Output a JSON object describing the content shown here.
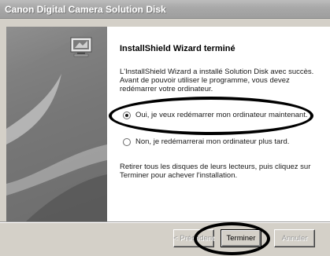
{
  "window": {
    "title": "Canon Digital Camera Solution Disk"
  },
  "wizard": {
    "heading": "InstallShield Wizard terminé",
    "message": "L'InstallShield Wizard a installé Solution Disk avec succès. Avant de pouvoir utiliser le programme, vous devez redémarrer votre ordinateur.",
    "options": [
      {
        "label": "Oui, je veux redémarrer mon ordinateur maintenant.",
        "selected": true
      },
      {
        "label": "Non, je redémarrerai mon ordinateur plus tard.",
        "selected": false
      }
    ],
    "instruction": "Retirer tous les disques de leurs lecteurs, puis cliquez sur Terminer pour achever l'installation."
  },
  "buttons": {
    "previous": "< Précédent",
    "finish": "Terminer",
    "cancel": "Annuler"
  },
  "annotations": {
    "color": "#000000"
  }
}
